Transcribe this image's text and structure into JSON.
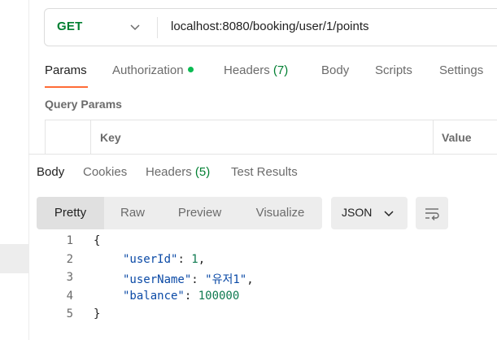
{
  "request": {
    "method": "GET",
    "url": "localhost:8080/booking/user/1/points"
  },
  "request_tabs": [
    {
      "label": "Params"
    },
    {
      "label": "Authorization"
    },
    {
      "label": "Headers",
      "count": "(7)"
    },
    {
      "label": "Body"
    },
    {
      "label": "Scripts"
    },
    {
      "label": "Settings"
    }
  ],
  "query_params": {
    "title": "Query Params",
    "col_key": "Key",
    "col_value": "Value"
  },
  "response_tabs": [
    {
      "label": "Body"
    },
    {
      "label": "Cookies"
    },
    {
      "label": "Headers",
      "count": "(5)"
    },
    {
      "label": "Test Results"
    }
  ],
  "formats": [
    "Pretty",
    "Raw",
    "Preview",
    "Visualize"
  ],
  "language": "JSON",
  "code": {
    "line_numbers": [
      "1",
      "2",
      "3",
      "4",
      "5"
    ],
    "open_brace": "{",
    "close_brace": "}",
    "fields": [
      {
        "key": "\"userId\"",
        "value": "1",
        "sep": ","
      },
      {
        "key": "\"userName\"",
        "value": "\"유저1\"",
        "sep": ","
      },
      {
        "key": "\"balance\"",
        "value": "100000",
        "sep": ""
      }
    ]
  }
}
